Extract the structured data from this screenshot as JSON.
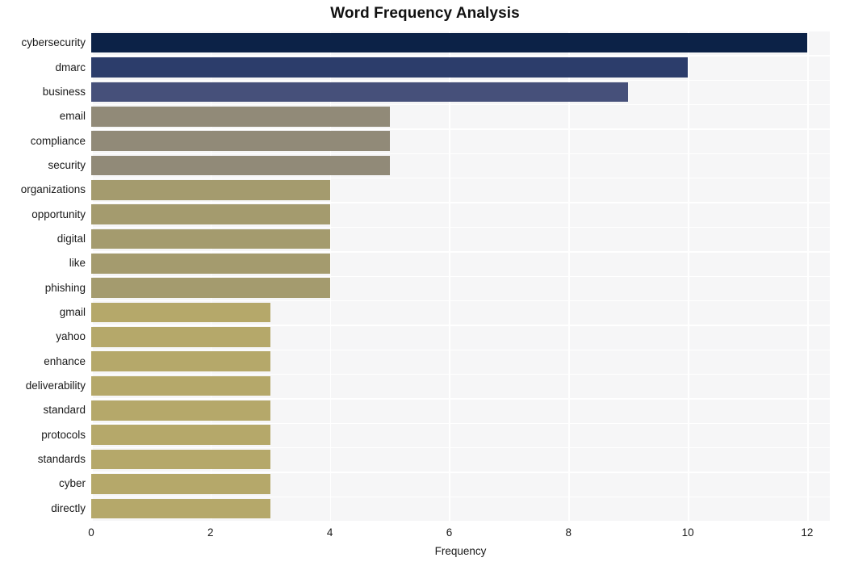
{
  "chart_data": {
    "type": "bar",
    "orientation": "horizontal",
    "title": "Word Frequency Analysis",
    "xlabel": "Frequency",
    "ylabel": "",
    "categories": [
      "cybersecurity",
      "dmarc",
      "business",
      "email",
      "compliance",
      "security",
      "organizations",
      "opportunity",
      "digital",
      "like",
      "phishing",
      "gmail",
      "yahoo",
      "enhance",
      "deliverability",
      "standard",
      "protocols",
      "standards",
      "cyber",
      "directly"
    ],
    "values": [
      12,
      10,
      9,
      5,
      5,
      5,
      4,
      4,
      4,
      4,
      4,
      3,
      3,
      3,
      3,
      3,
      3,
      3,
      3,
      3
    ],
    "bar_colors": [
      "#0c2247",
      "#2c3d6b",
      "#46507a",
      "#918a78",
      "#918a78",
      "#918a78",
      "#a49b6e",
      "#a49b6e",
      "#a49b6e",
      "#a49b6e",
      "#a49b6e",
      "#b5a86a",
      "#b5a86a",
      "#b5a86a",
      "#b5a86a",
      "#b5a86a",
      "#b5a86a",
      "#b5a86a",
      "#b5a86a",
      "#b5a86a"
    ],
    "xticks": [
      0,
      2,
      4,
      6,
      8,
      10,
      12
    ],
    "xticklabels": [
      "0",
      "2",
      "4",
      "6",
      "8",
      "10",
      "12"
    ],
    "xlim": [
      0,
      12.38
    ],
    "grid": true,
    "grid_color": "#ffffff",
    "plot_background": "#f6f6f7",
    "figure_background": "#ffffff",
    "legend": null,
    "legend_position": "none"
  }
}
